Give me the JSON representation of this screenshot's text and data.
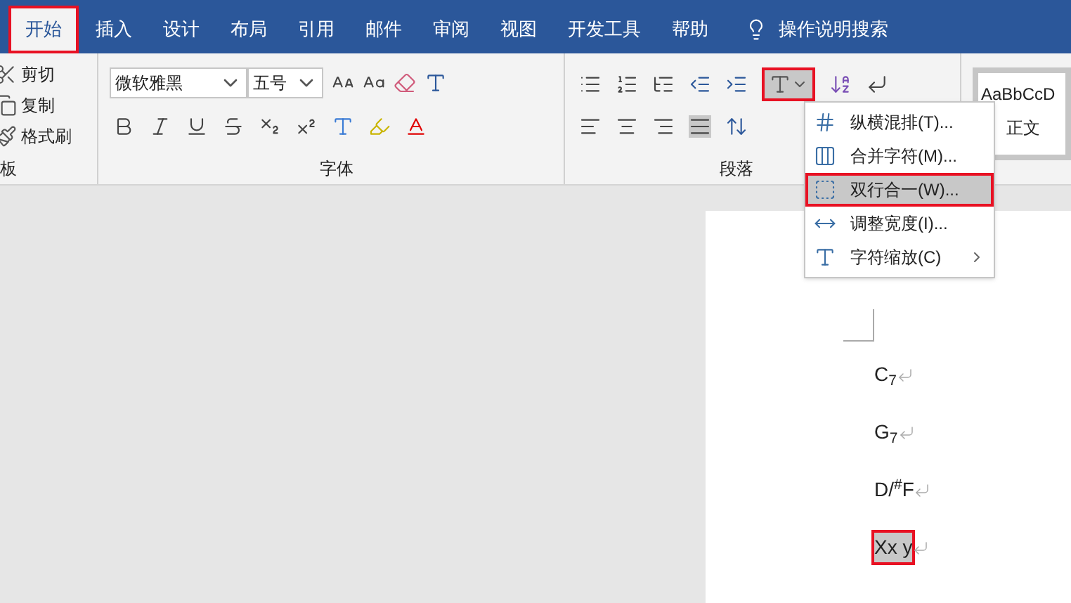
{
  "tabs": [
    {
      "label": "开始",
      "selected": true
    },
    {
      "label": "插入",
      "selected": false
    },
    {
      "label": "设计",
      "selected": false
    },
    {
      "label": "布局",
      "selected": false
    },
    {
      "label": "引用",
      "selected": false
    },
    {
      "label": "邮件",
      "selected": false
    },
    {
      "label": "审阅",
      "selected": false
    },
    {
      "label": "视图",
      "selected": false
    },
    {
      "label": "开发工具",
      "selected": false
    },
    {
      "label": "帮助",
      "selected": false
    }
  ],
  "search": {
    "label": "操作说明搜索"
  },
  "clipboard": {
    "items": [
      "剪切",
      "复制",
      "格式刷"
    ],
    "label": "板"
  },
  "font": {
    "name": "微软雅黑",
    "size": "五号",
    "label": "字体"
  },
  "paragraph": {
    "label": "段落",
    "char_button_selected": true
  },
  "styles": {
    "preview": "AaBbCcD",
    "name": "正文"
  },
  "menu": [
    {
      "label": "纵横混排(T)...",
      "kind": "vertical",
      "selected": false,
      "submenu": false
    },
    {
      "label": "合并字符(M)...",
      "kind": "combine",
      "selected": false,
      "submenu": false
    },
    {
      "label": "双行合一(W)...",
      "kind": "twolines",
      "selected": true,
      "submenu": false
    },
    {
      "label": "调整宽度(I)...",
      "kind": "width",
      "selected": false,
      "submenu": false
    },
    {
      "label": "字符缩放(C)",
      "kind": "scale",
      "selected": false,
      "submenu": true
    }
  ],
  "document": {
    "lines": [
      {
        "text": "C$_{7}$",
        "highlight": false
      },
      {
        "text": "G$_{7}$",
        "highlight": false
      },
      {
        "text": "D/$^{#}$F",
        "highlight": false
      },
      {
        "text": "Xx y",
        "highlight": true
      }
    ]
  }
}
